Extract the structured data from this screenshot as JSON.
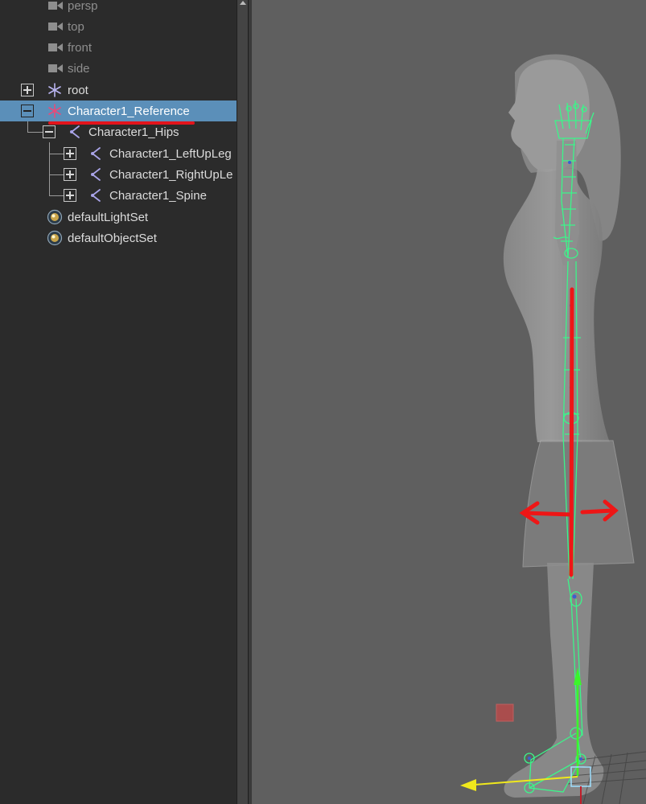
{
  "outliner": {
    "cameras": [
      {
        "label": "persp"
      },
      {
        "label": "top"
      },
      {
        "label": "front"
      },
      {
        "label": "side"
      }
    ],
    "root": {
      "label": "root"
    },
    "reference": {
      "label": "Character1_Reference"
    },
    "hips": {
      "label": "Character1_Hips"
    },
    "children": [
      {
        "label": "Character1_LeftUpLeg"
      },
      {
        "label": "Character1_RightUpLe"
      },
      {
        "label": "Character1_Spine"
      }
    ],
    "sets": [
      {
        "label": "defaultLightSet"
      },
      {
        "label": "defaultObjectSet"
      }
    ]
  },
  "colors": {
    "selection": "#5b8fb9",
    "annotation": "#e2141c",
    "joint_wire": "#3cf58a",
    "viewport_bg": "#5f5f5f"
  }
}
